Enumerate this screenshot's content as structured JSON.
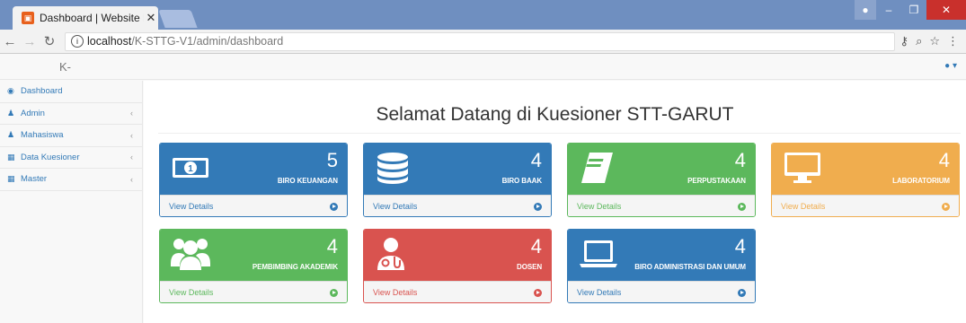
{
  "browser": {
    "tab_title": "Dashboard | Website Kue",
    "tab_close": "✕",
    "url_host": "localhost",
    "url_path": "/K-STTG-V1/admin/dashboard"
  },
  "header": {
    "brand": "K-",
    "user_menu": "▾"
  },
  "sidebar": {
    "items": [
      {
        "label": "Dashboard",
        "icon": "dashboard-icon"
      },
      {
        "label": "Admin",
        "icon": "user-icon"
      },
      {
        "label": "Mahasiswa",
        "icon": "users-icon"
      },
      {
        "label": "Data Kuesioner",
        "icon": "table-icon"
      },
      {
        "label": "Master",
        "icon": "table-icon"
      }
    ]
  },
  "main": {
    "title": "Selamat Datang di Kuesioner STT-GARUT",
    "view_details": "View Details",
    "panels": [
      {
        "count": "5",
        "label": "BIRO KEUANGAN",
        "color": "#337ab7",
        "icon": "money-icon"
      },
      {
        "count": "4",
        "label": "BIRO BAAK",
        "color": "#337ab7",
        "icon": "database-icon"
      },
      {
        "count": "4",
        "label": "PERPUSTAKAAN",
        "color": "#5cb85c",
        "icon": "book-icon"
      },
      {
        "count": "4",
        "label": "LABORATORIUM",
        "color": "#f0ad4e",
        "icon": "desktop-icon"
      },
      {
        "count": "4",
        "label": "PEMBIMBING AKADEMIK",
        "color": "#5cb85c",
        "icon": "group-icon"
      },
      {
        "count": "4",
        "label": "DOSEN",
        "color": "#d9534f",
        "icon": "doctor-icon"
      },
      {
        "count": "4",
        "label": "BIRO ADMINISTRASI DAN UMUM",
        "color": "#337ab7",
        "icon": "laptop-icon"
      }
    ]
  }
}
